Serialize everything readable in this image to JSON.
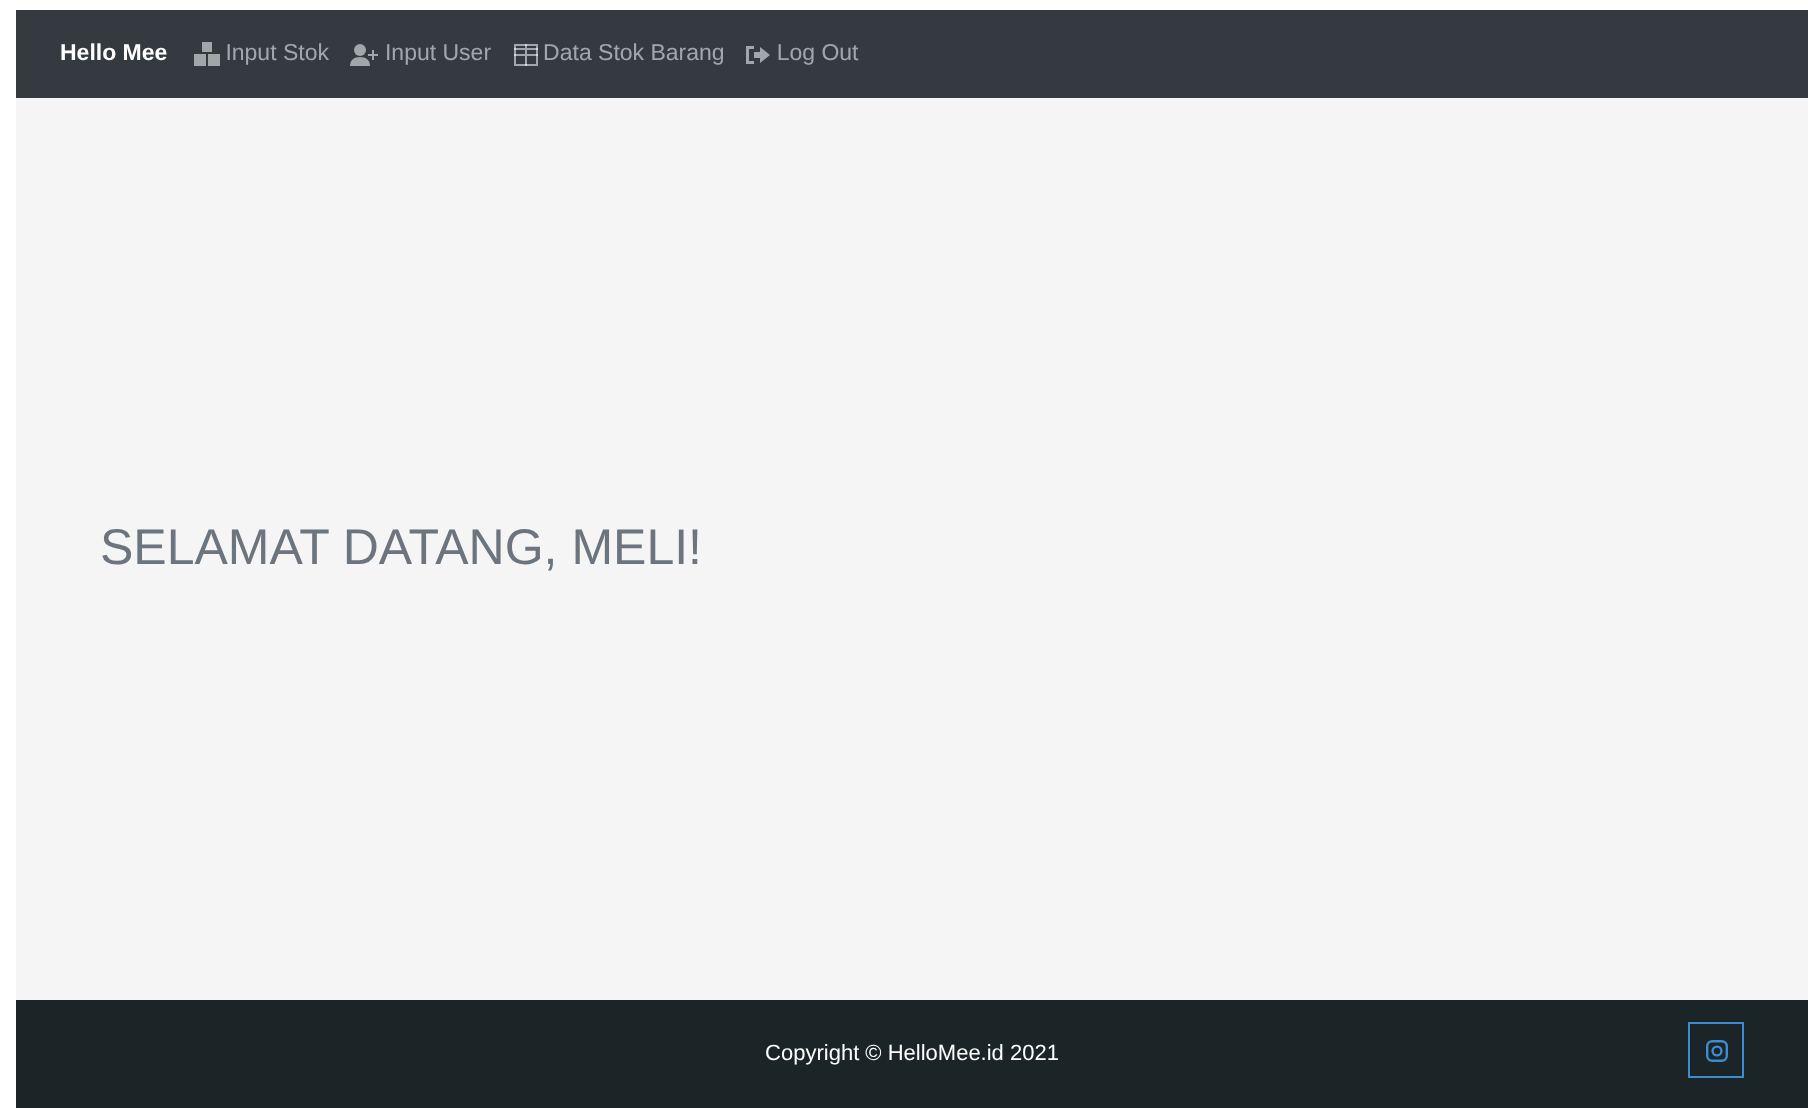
{
  "navbar": {
    "brand": "Hello Mee",
    "links": [
      {
        "kind": "stock",
        "label": "Input Stok"
      },
      {
        "kind": "user",
        "label": "Input User"
      },
      {
        "kind": "table",
        "label": "Data Stok Barang"
      },
      {
        "kind": "logout",
        "label": "Log Out"
      }
    ]
  },
  "main": {
    "heading": "SELAMAT DATANG, MELI!"
  },
  "footer": {
    "copyright": "Copyright © HelloMee.id 2021",
    "social": [
      {
        "kind": "instagram"
      }
    ]
  }
}
